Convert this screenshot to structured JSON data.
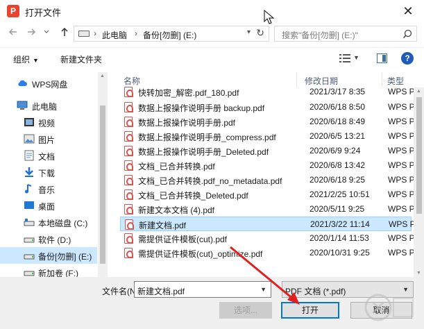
{
  "titlebar": {
    "logo_letter": "P",
    "title": "打开文件",
    "close_glyph": "✕"
  },
  "nav": {
    "back_icon": "arrow-left-icon",
    "forward_icon": "arrow-right-icon",
    "recent_icon": "chevron-down-icon",
    "up_icon": "arrow-up-icon",
    "breadcrumb": [
      "此电脑",
      "备份[勿删] (E:)"
    ],
    "search_placeholder": "搜索\"备份[勿删] (E:)\""
  },
  "toolbar": {
    "organize_label": "组织",
    "new_folder_label": "新建文件夹"
  },
  "sidebar": {
    "items": [
      {
        "label": "WPS网盘",
        "icon": "cloud-icon",
        "selected": false
      },
      {
        "label": "此电脑",
        "icon": "computer-icon",
        "selected": false
      },
      {
        "label": "视频",
        "icon": "video-folder-icon",
        "selected": false
      },
      {
        "label": "图片",
        "icon": "picture-folder-icon",
        "selected": false
      },
      {
        "label": "文档",
        "icon": "document-folder-icon",
        "selected": false
      },
      {
        "label": "下载",
        "icon": "download-folder-icon",
        "selected": false
      },
      {
        "label": "音乐",
        "icon": "music-folder-icon",
        "selected": false
      },
      {
        "label": "桌面",
        "icon": "desktop-folder-icon",
        "selected": false
      },
      {
        "label": "本地磁盘 (C:)",
        "icon": "drive-icon",
        "selected": false
      },
      {
        "label": "软件 (D:)",
        "icon": "drive-icon",
        "selected": false
      },
      {
        "label": "备份[勿删] (E:)",
        "icon": "drive-icon",
        "selected": true
      },
      {
        "label": "新加卷 (F:)",
        "icon": "drive-icon",
        "selected": false
      }
    ]
  },
  "files": {
    "columns": {
      "name": "名称",
      "date": "修改日期",
      "type": "类型"
    },
    "rows": [
      {
        "name": "快转加密_解密.pdf_180.pdf",
        "date": "2021/3/17 8:35",
        "type": "WPS P",
        "selected": false
      },
      {
        "name": "数据上报操作说明手册 backup.pdf",
        "date": "2020/6/18 8:50",
        "type": "WPS P",
        "selected": false
      },
      {
        "name": "数据上报操作说明手册.pdf",
        "date": "2020/6/18 8:49",
        "type": "WPS P",
        "selected": false
      },
      {
        "name": "数据上报操作说明手册_compress.pdf",
        "date": "2020/6/5 13:21",
        "type": "WPS P",
        "selected": false
      },
      {
        "name": "数据上报操作说明手册_Deleted.pdf",
        "date": "2020/6/9 9:24",
        "type": "WPS P",
        "selected": false
      },
      {
        "name": "文档_已合并转换.pdf",
        "date": "2020/6/8 13:42",
        "type": "WPS P",
        "selected": false
      },
      {
        "name": "文档_已合并转换.pdf_no_metadata.pdf",
        "date": "2020/6/18 9:25",
        "type": "WPS P",
        "selected": false
      },
      {
        "name": "文档_已合并转换_Deleted.pdf",
        "date": "2021/2/25 10:51",
        "type": "WPS P",
        "selected": false
      },
      {
        "name": "新建文本文档 (4).pdf",
        "date": "2020/5/11 9:25",
        "type": "WPS P",
        "selected": false
      },
      {
        "name": "新建文档.pdf",
        "date": "2021/3/22 11:14",
        "type": "WPS P",
        "selected": true
      },
      {
        "name": "需提供证件模板(cut).pdf",
        "date": "2020/1/14 11:53",
        "type": "WPS P",
        "selected": false
      },
      {
        "name": "需提供证件模板(cut)_optimize.pdf",
        "date": "2020/10/31 9:25",
        "type": "WPS P",
        "selected": false
      }
    ]
  },
  "bottom": {
    "filename_label": "文件名(N):",
    "filename_value": "新建文档.pdf",
    "filetype_value": "PDF 文档 (*.pdf)",
    "options_label": "选项...",
    "open_label": "打开",
    "cancel_label": "取消"
  },
  "colors": {
    "selection": "#cce8ff",
    "accent": "#0078d7",
    "annotation_arrow": "#e02020"
  }
}
